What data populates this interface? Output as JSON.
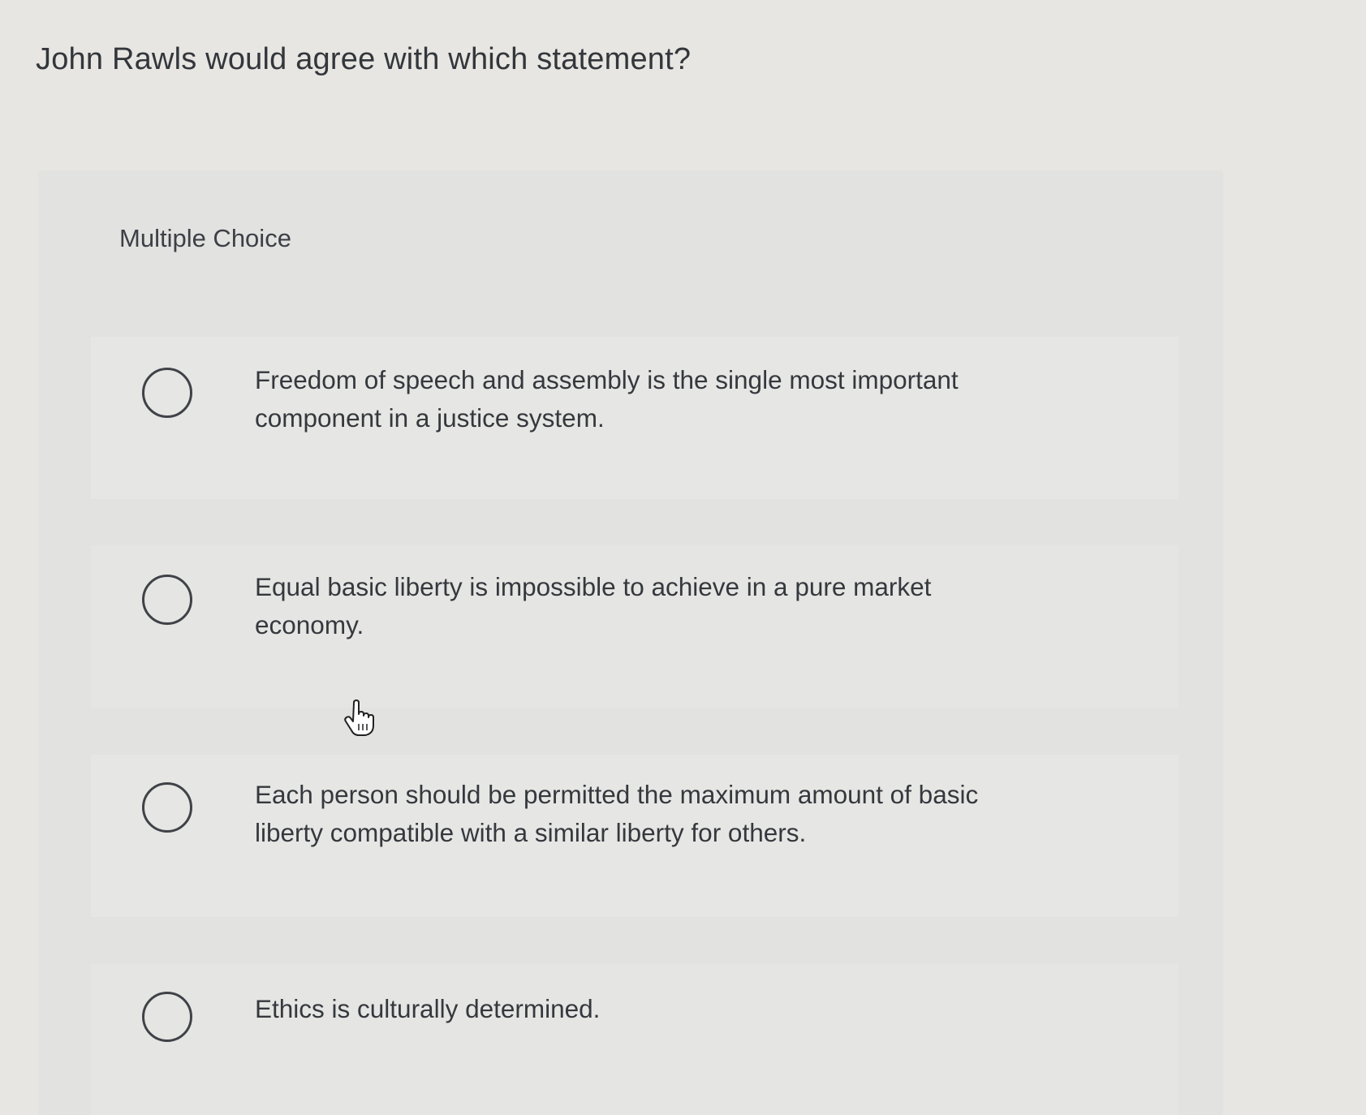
{
  "question": {
    "title": "John Rawls would agree with which statement?"
  },
  "choices": {
    "label": "Multiple Choice",
    "options": [
      {
        "text": "Freedom of speech and assembly is the single most important component in a justice system."
      },
      {
        "text": "Equal basic liberty is impossible to achieve in a pure market economy."
      },
      {
        "text": "Each person should be permitted the maximum amount of basic liberty compatible with a similar liberty for others."
      },
      {
        "text": "Ethics is culturally determined."
      }
    ]
  },
  "icons": {
    "radio": "radio-unselected-icon",
    "cursor": "hand-pointer-icon"
  }
}
